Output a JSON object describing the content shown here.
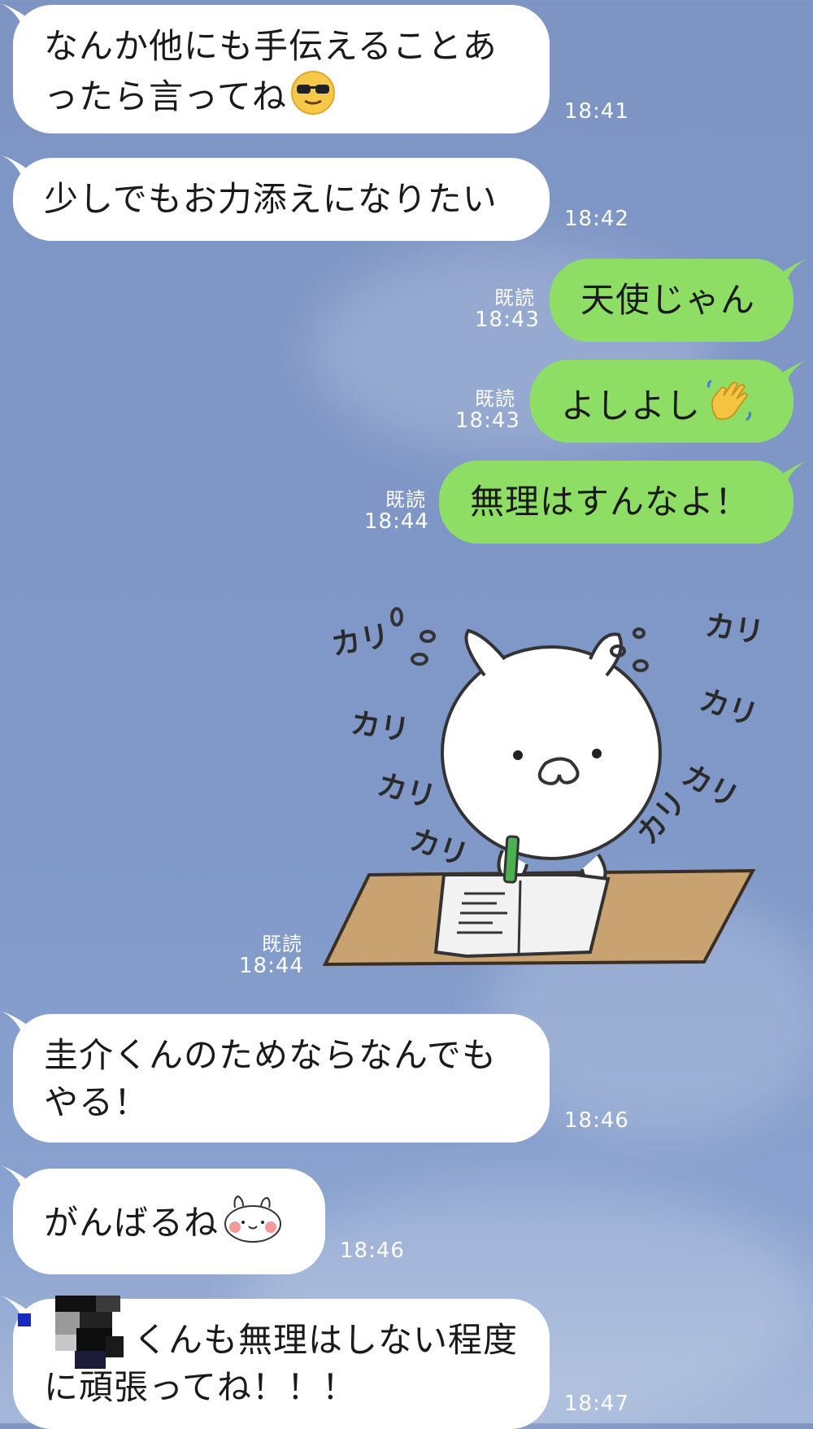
{
  "messages": [
    {
      "id": "m1",
      "side": "left",
      "lines": [
        "なんか他にも手伝えることあ",
        "ったら言ってね"
      ],
      "emoji": "sunglasses-emoji",
      "time": "18:41"
    },
    {
      "id": "m2",
      "side": "left",
      "lines": [
        "少しでもお力添えになりたい"
      ],
      "time": "18:42"
    },
    {
      "id": "m3",
      "side": "right",
      "lines": [
        "天使じゃん"
      ],
      "read": "既読",
      "time": "18:43"
    },
    {
      "id": "m4",
      "side": "right",
      "lines": [
        "よしよし"
      ],
      "emoji": "waving-hand-emoji",
      "read": "既読",
      "time": "18:43"
    },
    {
      "id": "m5",
      "side": "right",
      "lines": [
        "無理はすんなよ！"
      ],
      "read": "既読",
      "time": "18:44"
    },
    {
      "id": "m6",
      "side": "right",
      "type": "sticker",
      "sticker": "rabbit-writing-sticker",
      "sticker_text": [
        "カリ",
        "カリ",
        "カリ",
        "カリ",
        "カリ",
        "カリ",
        "カリ",
        "カリ"
      ],
      "read": "既読",
      "time": "18:44"
    },
    {
      "id": "m7",
      "side": "left",
      "lines": [
        "圭介くんのためならなんでも",
        "やる！"
      ],
      "time": "18:46"
    },
    {
      "id": "m8",
      "side": "left",
      "lines": [
        "がんばるね"
      ],
      "emoji": "rabbit-face-emoji",
      "time": "18:46"
    },
    {
      "id": "m9",
      "side": "left",
      "lines": [
        "くんも無理はしない程度",
        "に頑張ってね！！！"
      ],
      "redacted": true,
      "time": "18:47"
    }
  ],
  "colors": {
    "sent_bubble": "#8ede65",
    "received_bubble": "#ffffff",
    "background": "#7f96c6",
    "meta_text": "#ffffff"
  }
}
